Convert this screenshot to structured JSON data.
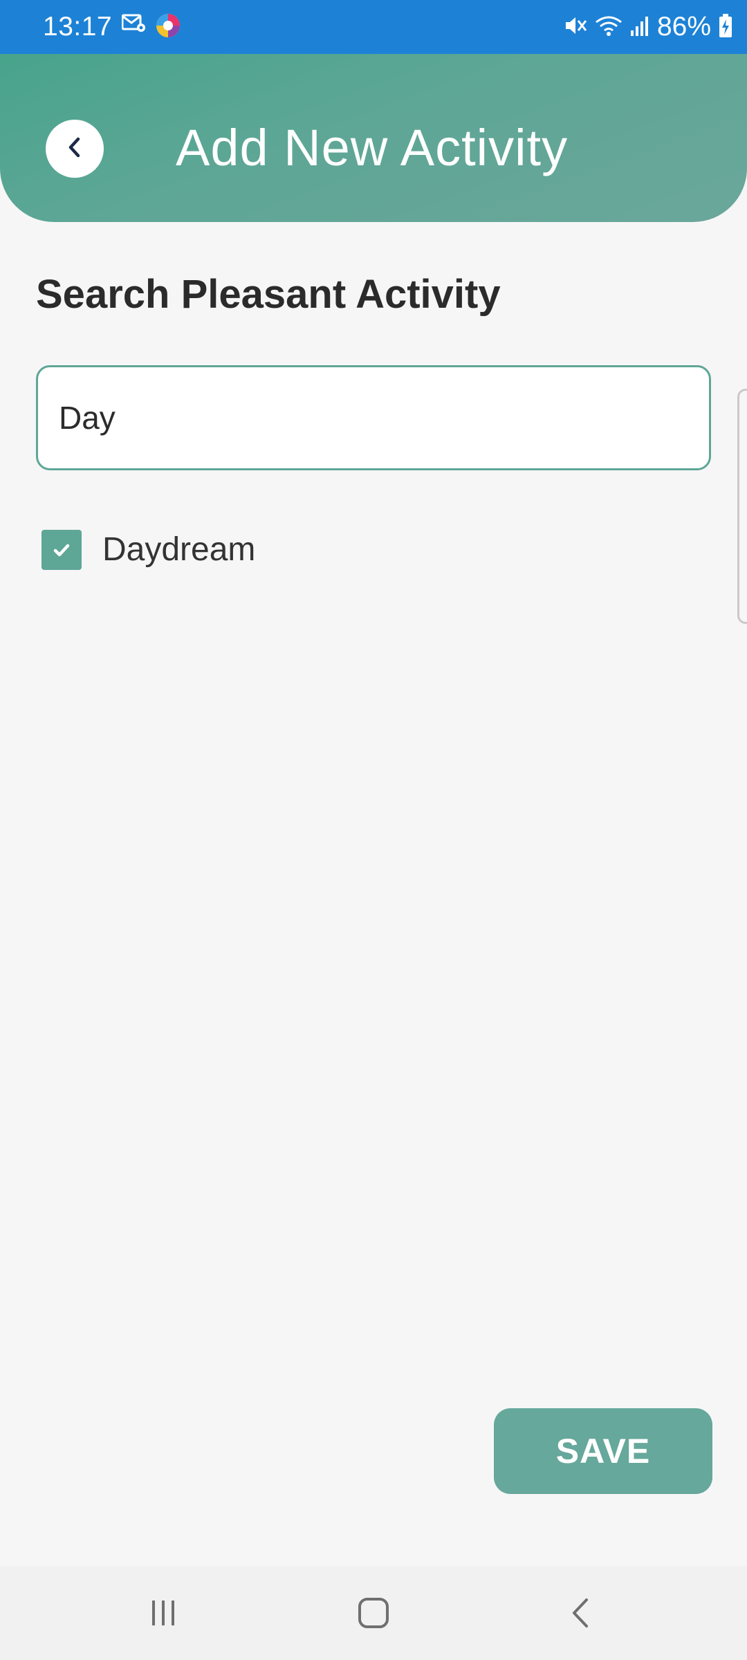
{
  "status_bar": {
    "time": "13:17",
    "battery": "86%",
    "icons": [
      "mail-settings-icon",
      "app-icon",
      "mute-icon",
      "wifi-icon",
      "signal-icon",
      "battery-charging-icon"
    ]
  },
  "header": {
    "title": "Add New Activity",
    "back_icon": "chevron-left-icon"
  },
  "search": {
    "section_title": "Search Pleasant Activity",
    "value": "Day"
  },
  "results": [
    {
      "label": "Daydream",
      "checked": true
    }
  ],
  "actions": {
    "save_label": "SAVE"
  },
  "nav": {
    "recents_icon": "recent-apps-icon",
    "home_icon": "home-icon",
    "back_icon": "back-icon"
  },
  "colors": {
    "status_bar": "#1d82d6",
    "accent": "#5ea696",
    "button": "#66a89b",
    "background": "#f6f6f6"
  }
}
